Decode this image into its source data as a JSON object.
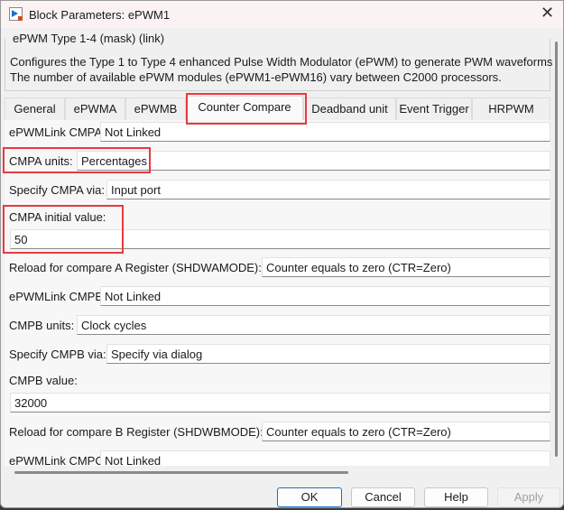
{
  "window": {
    "title": "Block Parameters: ePWM1"
  },
  "mask": {
    "title": "ePWM Type 1-4 (mask) (link)",
    "description": [
      "Configures the Type 1 to Type 4 enhanced Pulse Width Modulator (ePWM) to generate PWM waveforms",
      "The number of available ePWM modules (ePWM1-ePWM16) vary between C2000 processors."
    ]
  },
  "tabs": [
    {
      "label": "General"
    },
    {
      "label": "ePWMA"
    },
    {
      "label": "ePWMB"
    },
    {
      "label": "Counter Compare",
      "active": true
    },
    {
      "label": "Deadband unit"
    },
    {
      "label": "Event Trigger"
    },
    {
      "label": "HRPWM"
    }
  ],
  "params": [
    {
      "label": "ePWMLink CMPA",
      "value": "Not Linked"
    },
    {
      "label": "CMPA units:",
      "value": "Percentages"
    },
    {
      "label": "Specify CMPA via:",
      "value": "Input port"
    },
    {
      "label": "CMPA initial value:",
      "value": "50"
    },
    {
      "label": "Reload for compare A Register (SHDWAMODE):",
      "value": "Counter equals to zero (CTR=Zero)"
    },
    {
      "label": "ePWMLink CMPB",
      "value": "Not Linked"
    },
    {
      "label": "CMPB units:",
      "value": "Clock cycles"
    },
    {
      "label": "Specify CMPB via:",
      "value": "Specify via dialog"
    },
    {
      "label": "CMPB value:",
      "value": "32000"
    },
    {
      "label": "Reload for compare B Register (SHDWBMODE):",
      "value": "Counter equals to zero (CTR=Zero)"
    },
    {
      "label": "ePWMLink CMPC",
      "value": "Not Linked"
    }
  ],
  "buttons": {
    "ok": "OK",
    "cancel": "Cancel",
    "help": "Help",
    "apply": "Apply"
  },
  "colors": {
    "highlight": "#e8393f",
    "accent": "#1f6fc4"
  }
}
